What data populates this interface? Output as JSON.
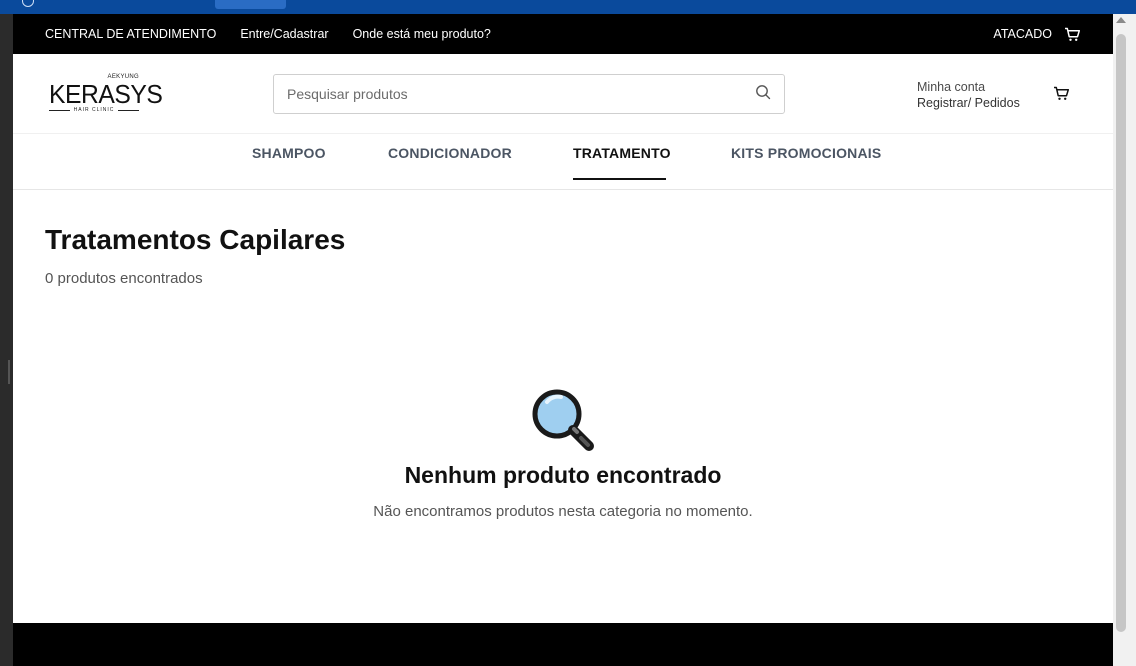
{
  "topbar": {
    "links": [
      "CENTRAL DE ATENDIMENTO",
      "Entre/Cadastrar",
      "Onde está meu produto?"
    ],
    "atacado": "ATACADO"
  },
  "header": {
    "logo": {
      "brand": "KERASYS",
      "maker": "AEKYUNG",
      "sub": "HAIR CLINIC"
    },
    "search_placeholder": "Pesquisar produtos",
    "account_label": "Minha conta",
    "account_links": "Registrar/ Pedidos"
  },
  "categories": [
    "SHAMPOO",
    "CONDICIONADOR",
    "TRATAMENTO",
    "KITS PROMOCIONAIS"
  ],
  "active_category": "TRATAMENTO",
  "page": {
    "title": "Tratamentos Capilares",
    "count": "0 produtos encontrados"
  },
  "empty_state": {
    "icon": "magnifier-icon",
    "title": "Nenhum produto encontrado",
    "message": "Não encontramos produtos nesta categoria no momento."
  }
}
